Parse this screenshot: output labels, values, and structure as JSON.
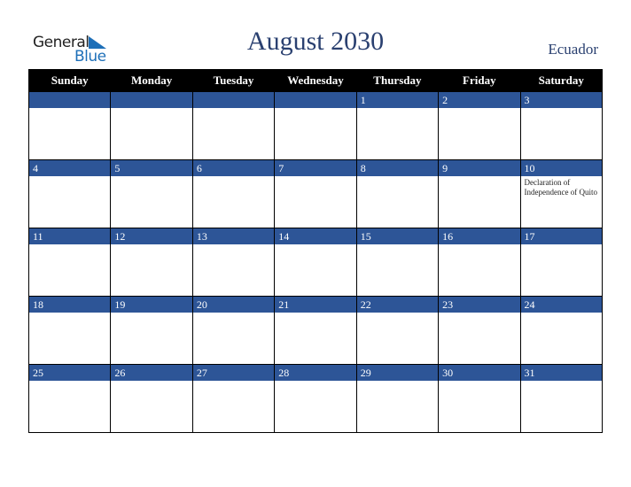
{
  "logo": {
    "line1": "General",
    "line2": "Blue"
  },
  "title": "August 2030",
  "country": "Ecuador",
  "weekdays": [
    "Sunday",
    "Monday",
    "Tuesday",
    "Wednesday",
    "Thursday",
    "Friday",
    "Saturday"
  ],
  "weeks": [
    [
      {
        "day": ""
      },
      {
        "day": ""
      },
      {
        "day": ""
      },
      {
        "day": ""
      },
      {
        "day": "1"
      },
      {
        "day": "2"
      },
      {
        "day": "3"
      }
    ],
    [
      {
        "day": "4"
      },
      {
        "day": "5"
      },
      {
        "day": "6"
      },
      {
        "day": "7"
      },
      {
        "day": "8"
      },
      {
        "day": "9"
      },
      {
        "day": "10",
        "event": "Declaration of Independence of Quito"
      }
    ],
    [
      {
        "day": "11"
      },
      {
        "day": "12"
      },
      {
        "day": "13"
      },
      {
        "day": "14"
      },
      {
        "day": "15"
      },
      {
        "day": "16"
      },
      {
        "day": "17"
      }
    ],
    [
      {
        "day": "18"
      },
      {
        "day": "19"
      },
      {
        "day": "20"
      },
      {
        "day": "21"
      },
      {
        "day": "22"
      },
      {
        "day": "23"
      },
      {
        "day": "24"
      }
    ],
    [
      {
        "day": "25"
      },
      {
        "day": "26"
      },
      {
        "day": "27"
      },
      {
        "day": "28"
      },
      {
        "day": "29"
      },
      {
        "day": "30"
      },
      {
        "day": "31"
      }
    ]
  ],
  "colors": {
    "header_bg": "#000000",
    "day_bar": "#2d5597",
    "title": "#2a4070",
    "logo_blue": "#1d6fb8"
  }
}
